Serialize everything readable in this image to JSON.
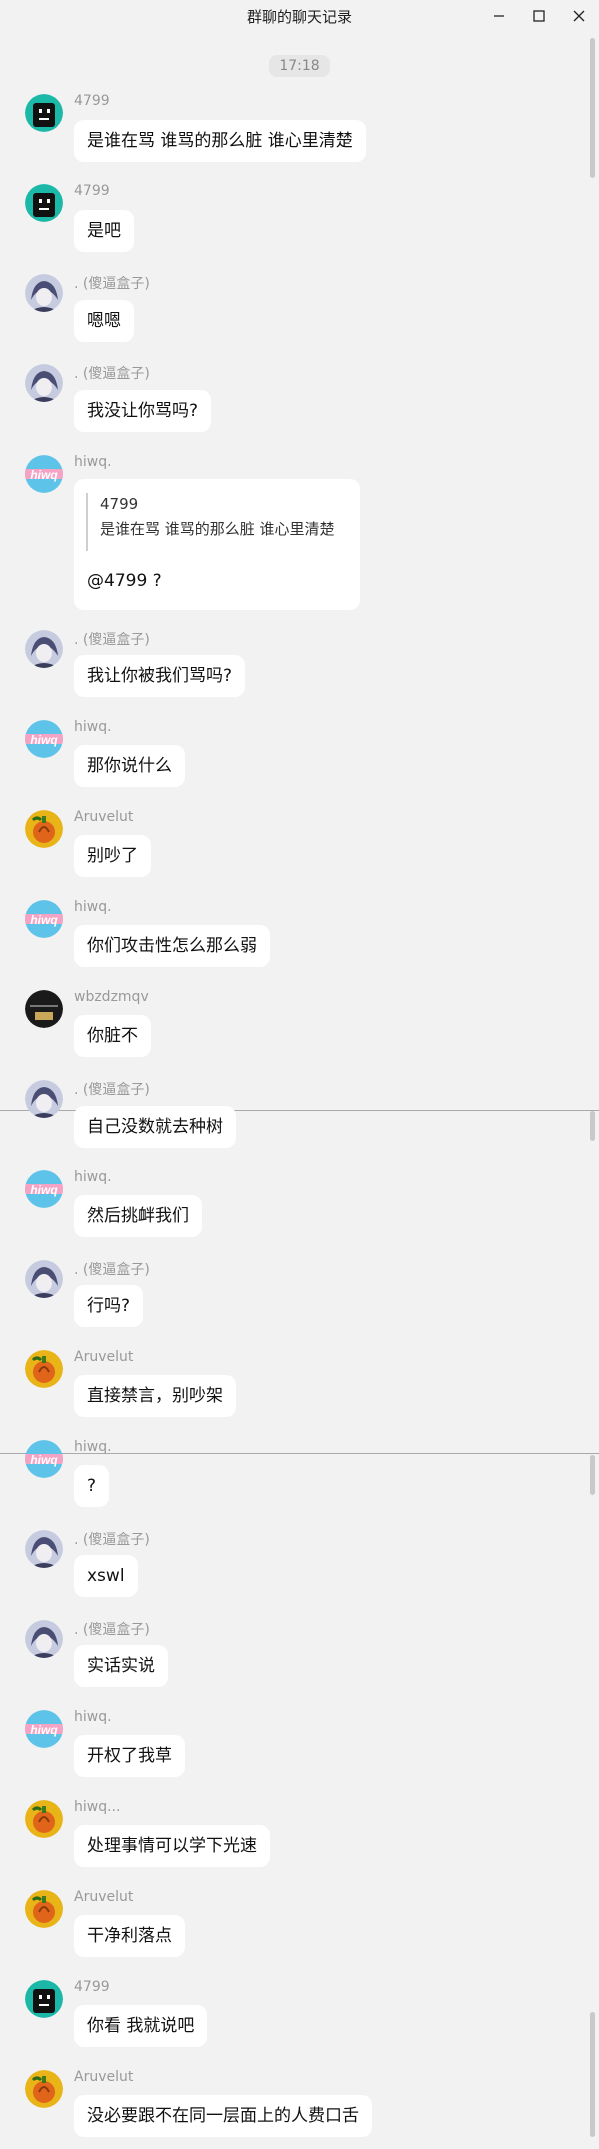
{
  "window": {
    "title": "群聊的聊天记录",
    "controls": [
      "minimize",
      "maximize",
      "close"
    ]
  },
  "timestamp": "17:18",
  "colors": {
    "background": "#f2f2f2",
    "bubble": "#ffffff",
    "sender": "#999999"
  },
  "messages": [
    {
      "sender": "4799",
      "avatar": "teal-robot-avatar",
      "text": "是谁在骂 谁骂的那么脏 谁心里清楚"
    },
    {
      "sender": "4799",
      "avatar": "teal-robot-avatar",
      "text": "是吧"
    },
    {
      "sender": ". (傻逼盒子)",
      "avatar": "anime-avatar",
      "text": "嗯嗯"
    },
    {
      "sender": ". (傻逼盒子)",
      "avatar": "anime-avatar",
      "text": "我没让你骂吗?"
    },
    {
      "sender": "hiwq.",
      "avatar": "hiwq-avatar",
      "quote_name": "4799",
      "quote_text": "是谁在骂 谁骂的那么脏 谁心里清楚",
      "text": "@4799 ?"
    },
    {
      "sender": ". (傻逼盒子)",
      "avatar": "anime-avatar",
      "text": "我让你被我们骂吗?"
    },
    {
      "sender": "hiwq.",
      "avatar": "hiwq-avatar",
      "text": "那你说什么"
    },
    {
      "sender": "Aruvelut",
      "avatar": "pumpkin-avatar",
      "text": "别吵了"
    },
    {
      "sender": "hiwq.",
      "avatar": "hiwq-avatar",
      "text": "你们攻击性怎么那么弱"
    },
    {
      "sender": "wbzdzmqv",
      "avatar": "dark-avatar",
      "text": "你脏不"
    },
    {
      "sender": ". (傻逼盒子)",
      "avatar": "anime-avatar",
      "text": "自己没数就去种树"
    },
    {
      "sender": "hiwq.",
      "avatar": "hiwq-avatar",
      "text": "然后挑衅我们"
    },
    {
      "sender": ". (傻逼盒子)",
      "avatar": "anime-avatar",
      "text": "行吗?"
    },
    {
      "sender": "Aruvelut",
      "avatar": "pumpkin-avatar",
      "text": "直接禁言，别吵架"
    },
    {
      "sender": "hiwq.",
      "avatar": "hiwq-avatar",
      "text": "?"
    },
    {
      "sender": ". (傻逼盒子)",
      "avatar": "anime-avatar",
      "text": "xswl"
    },
    {
      "sender": ". (傻逼盒子)",
      "avatar": "anime-avatar",
      "text": "实话实说"
    },
    {
      "sender": "hiwq.",
      "avatar": "hiwq-avatar",
      "text": "开权了我草"
    },
    {
      "sender": "hiwq...",
      "avatar": "pumpkin-avatar",
      "text": "处理事情可以学下光速"
    },
    {
      "sender": "Aruvelut",
      "avatar": "pumpkin-avatar",
      "text": "干净利落点"
    },
    {
      "sender": "4799",
      "avatar": "teal-robot-avatar",
      "text": "你看 我就说吧"
    },
    {
      "sender": "Aruvelut",
      "avatar": "pumpkin-avatar",
      "text": "没必要跟不在同一层面上的人费口舌"
    }
  ]
}
